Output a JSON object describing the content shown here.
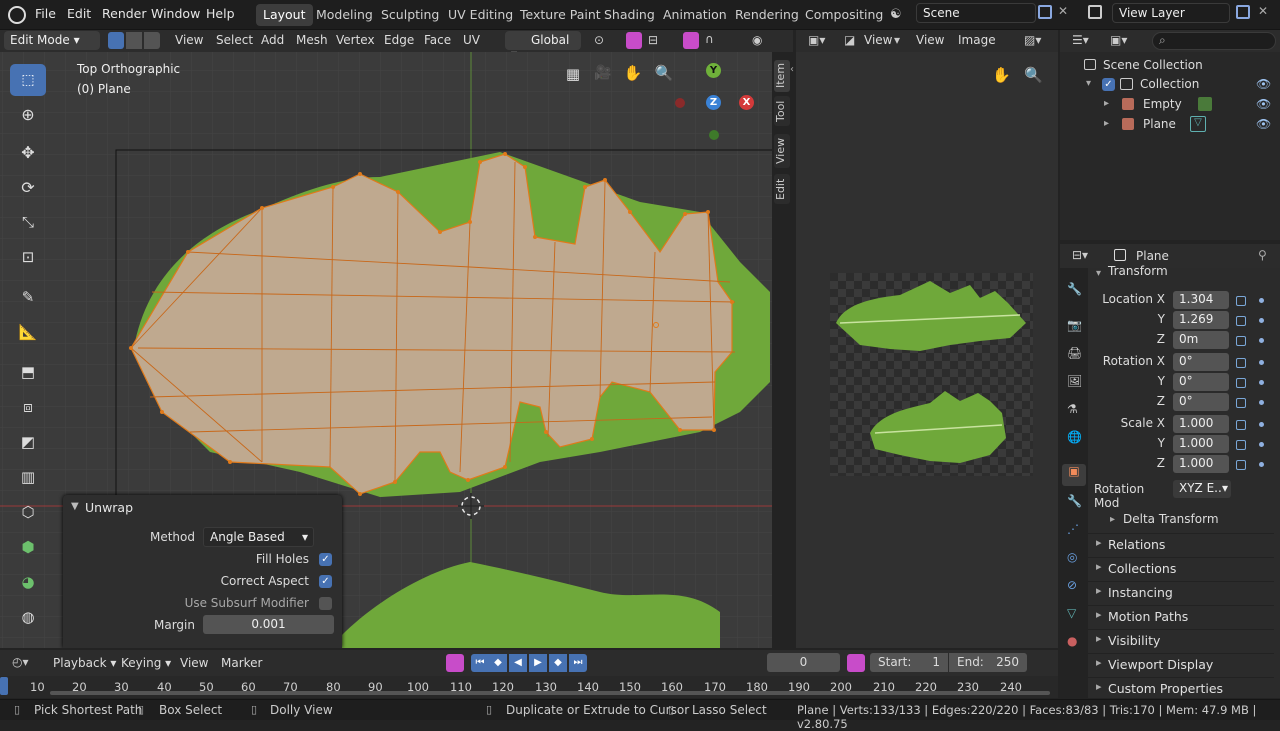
{
  "menubar": {
    "items": [
      "File",
      "Edit",
      "Render",
      "Window",
      "Help"
    ],
    "workspaces": [
      "Layout",
      "Modeling",
      "Sculpting",
      "UV Editing",
      "Texture Paint",
      "Shading",
      "Animation",
      "Rendering",
      "Compositing"
    ],
    "active_workspace": "Layout",
    "scene": "Scene",
    "view_layer": "View Layer"
  },
  "viewport_header": {
    "mode": "Edit Mode",
    "menus": [
      "View",
      "Select",
      "Add",
      "Mesh",
      "Vertex",
      "Edge",
      "Face",
      "UV"
    ],
    "orientation": "Global"
  },
  "viewport": {
    "view_name": "Top Orthographic",
    "object_label": "(0) Plane",
    "side_tabs": [
      "Item",
      "Tool",
      "View",
      "Edit"
    ],
    "gizmo": {
      "y": "Y",
      "z": "Z",
      "x": "X"
    }
  },
  "unwrap_panel": {
    "title": "Unwrap",
    "method_label": "Method",
    "method_value": "Angle Based",
    "fill_holes_label": "Fill Holes",
    "fill_holes": true,
    "correct_aspect_label": "Correct Aspect",
    "correct_aspect": true,
    "subsurf_label": "Use Subsurf Modifier",
    "subsurf": false,
    "margin_label": "Margin",
    "margin_value": "0.001"
  },
  "image_editor": {
    "menus": [
      "View",
      "View",
      "Image"
    ]
  },
  "outliner": {
    "root": "Scene Collection",
    "collection": "Collection",
    "items": [
      "Empty",
      "Plane"
    ]
  },
  "properties": {
    "object_name": "Plane",
    "transform_label": "Transform",
    "location": {
      "label": "Location X",
      "x": "1.304",
      "y": "1.269",
      "z": "0m"
    },
    "rotation": {
      "label": "Rotation X",
      "x": "0°",
      "y": "0°",
      "z": "0°"
    },
    "scale": {
      "label": "Scale X",
      "x": "1.000",
      "y": "1.000",
      "z": "1.000"
    },
    "axis_y": "Y",
    "axis_z": "Z",
    "rotation_mode_label": "Rotation Mod",
    "rotation_mode_value": "XYZ E..",
    "delta_transform": "Delta Transform",
    "sections": [
      "Relations",
      "Collections",
      "Instancing",
      "Motion Paths",
      "Visibility",
      "Viewport Display",
      "Custom Properties"
    ]
  },
  "timeline": {
    "menus": [
      "Playback",
      "Keying",
      "View",
      "Marker"
    ],
    "current_frame": "0",
    "start_label": "Start:",
    "start_value": "1",
    "end_label": "End:",
    "end_value": "250",
    "ticks": [
      "10",
      "20",
      "30",
      "40",
      "50",
      "60",
      "70",
      "80",
      "90",
      "100",
      "110",
      "120",
      "130",
      "140",
      "150",
      "160",
      "170",
      "180",
      "190",
      "200",
      "210",
      "220",
      "230",
      "240"
    ]
  },
  "statusbar": {
    "left1": "Pick Shortest Path",
    "left2": "Box Select",
    "left3": "Dolly View",
    "mid1": "Duplicate or Extrude to Cursor",
    "mid2": "Lasso Select",
    "stats": "Plane | Verts:133/133 | Edges:220/220 | Faces:83/83 | Tris:170 | Mem: 47.9 MB | v2.80.75"
  },
  "colors": {
    "accent": "#4772b3",
    "mesh_fill": "#bfa98f",
    "edge": "#e07a1a",
    "leaf": "#6fa83a"
  }
}
